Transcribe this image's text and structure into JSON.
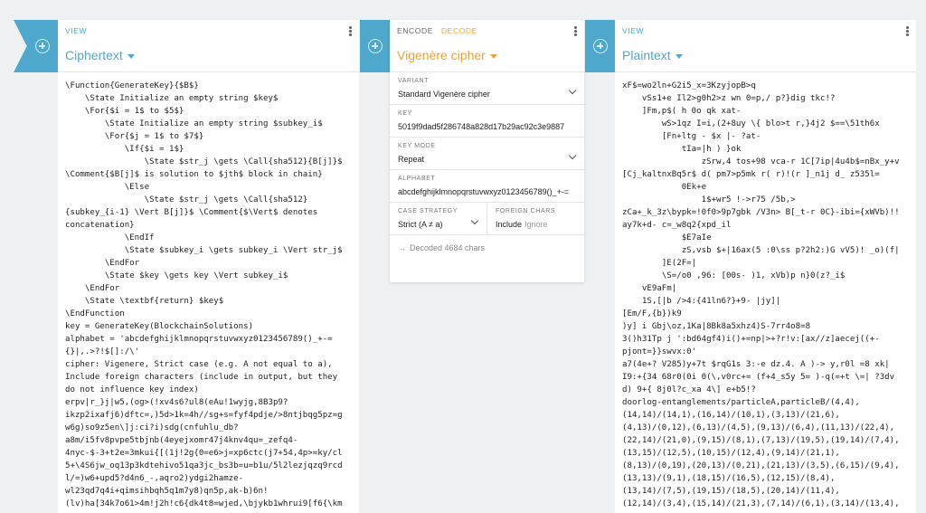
{
  "left": {
    "tab": "VIEW",
    "title": "Ciphertext",
    "content": "\\Function{GenerateKey}{$B$}\n    \\State Initialize an empty string $key$\n    \\For{$i = 1$ to $5$}\n        \\State Initialize an empty string $subkey_i$\n        \\For{$j = 1$ to $7$}\n            \\If{$i = 1$}\n                \\State $str_j \\gets \\Call{sha512}{B[j]}$\n\\Comment{$B[j]$ is solution to $jth$ block in chain}\n            \\Else\n                \\State $str_j \\gets \\Call{sha512}\n{subkey_{i-1} \\Vert B[j]}$ \\Comment{$\\Vert$ denotes\nconcatenation}\n            \\EndIf\n            \\State $subkey_i \\gets subkey_i \\Vert str_j$\n        \\EndFor\n        \\State $key \\gets key \\Vert subkey_i$\n    \\EndFor\n    \\State \\textbf{return} $key$\n\\EndFunction\nkey = GenerateKey(BlockchainSolutions)\nalphabet = 'abcdefghijklmnopqrstuvwxyz0123456789()_+-=\n{}|,.>?!$[]:/\\'\ncipher: Vigenere, Strict case (e.g. A not equal to a),\nInclude foreign characters (include in output, but they\ndo not influence key index)\nerpv|r_}j|w5,(og>(!xv4s6?ul8(eAu!1wyjg,8B3p9?\nikzp2ixafj6)dftc=,)5d>1k=4h//sg+s=fyf4pdje/>8ntjbqg5pz=g\nw6g)so9z5en\\]j:ci?i)sdg(cnfuhlu_db?\na8m/i5fv8pvpe5tbjnb(4eyejxomr47j4knv4qu=_zefq4-\n4nyc-$-3+t2e=3mkui{[(1j!2g{0=e6>j=xp6ctc(j7+54,4p>=ky/cl\n5+\\4S6jw_oq13p3kdtehivo51qa3jc_bs3b=u=b1u/5l2lezjqzq9rcd\nl/=)w6+upd5?d4n6_-,aqro2)ydgi2hamze-\nwl23qd7q4i+qimsihbqh5q1m7y8)qn5p,ak-b)6n!\n(lv)ha[34k7o61>4m!j2h!c6{dk4t8=wjed,\\bjykb1whrui9[f6{\\km"
  },
  "middle": {
    "tab_encode": "ENCODE",
    "tab_decode": "DECODE",
    "title": "Vigenère cipher",
    "variant_label": "VARIANT",
    "variant_value": "Standard Vigenère cipher",
    "key_label": "KEY",
    "key_value": "5019f9dad5f286748a828d17b29ac92c3e9887",
    "key_mode_label": "KEY MODE",
    "key_mode_value": "Repeat",
    "alphabet_label": "ALPHABET",
    "alphabet_value": "abcdefghijklmnopqrstuvwxyz0123456789()_+-=",
    "case_label": "CASE STRATEGY",
    "case_value": "Strict (A ≠ a)",
    "foreign_label": "FOREIGN CHARS",
    "foreign_include": "Include",
    "foreign_ignore": "Ignore",
    "status": "Decoded 4684 chars"
  },
  "right": {
    "tab": "VIEW",
    "title": "Plaintext",
    "content": "xF$=wo2ln+G2i5_x=3KzyjopB>q\n    vSs1+e Il2>g0h2>z wn 0=p,/ p?}dig tkc!?\n    ]Fm,p$( h 0o qk xat-\n        wS>1qz I=i,(2+8uy \\{ blo>t r,}4j2 $==\\51th6x\n        [Fn+ltg - $x |- ?at-\n            tIa=|h ) }ok\n                zSrw,4 tos+98 vca-r 1C[7ip|4u4b$=nBx_y+v\n[Cj_kaltnxBq5r$ d( pm7>p5mk r( r)!(r ]_n1j d_ z535l=\n            0Ek+e\n                1$+wr5 !->r75 /5b,>\nzCa+_k_3z\\bypk=!0f0>9p7gbk /V3n> B[_t-r 0C}-ibi={xWVb)!!\nay7k+d- c=_w8q2{xpd_il\n            $E7aIe\n            zS,vsb $+|16ax(5 :0\\ss p?2h2:)G vV5)! _o)(f|\n        ]E(2F=|\n        \\S=/o0 ,96: [00s- )1, xVb)p n}0(z?_i$\n    vE9aFm|\n    1S,[|b />4:{41ln6?}+9- |jy]|\n[Em/F,{b})k9\n)y] i Gbj\\oz,1Ka|8Bk8a5xhz4)S-7rr4o8=8\n3()h31Tp j ':bd64gf4)i()+=np|>+?r!v:[ax//z]aecej((+-\npjont=}}swvx:0'\na7(4e+? V285)y+7t $rqG1s 3:-e dz.4. A )-> y,r0l =8 xk|\nI9:+{34 68r0(0i 0(\\,v0rc+= (f+4_s5y 5= )-q(=+t \\=| ?3dv\nd) 9+{ 8j0l?c_xa 4\\] e+b5!?\ndoorlog-entanglements/particleA,particleB/(4,4),\n(14,14)/(14,1),(16,14)/(10,1),(3,13)/(21,6),\n(4,13)/(0,12),(6,13)/(4,5),(9,13)/(6,4),(11,13)/(22,4),\n(22,14)/(21,0),(9,15)/(8,1),(7,13)/(19,5),(19,14)/(7,4),\n(13,15)/(12,5),(10,15)/(12,4),(9,14)/(21,1),\n(8,13)/(0,19),(20,13)/(0,21),(21,13)/(3,5),(6,15)/(9,4),\n(13,13)/(9,1),(18,15)/(16,5),(12,15)/(8,4),\n(13,14)/(7,5),(19,15)/(18,5),(20,14)/(11,4),\n(12,14)/(3,4),(15,14)/(21,3),(7,14)/(6,1),(3,14)/(13,4),"
  },
  "colors": {
    "accent": "#4ea8cd",
    "orange": "#f0a030"
  }
}
